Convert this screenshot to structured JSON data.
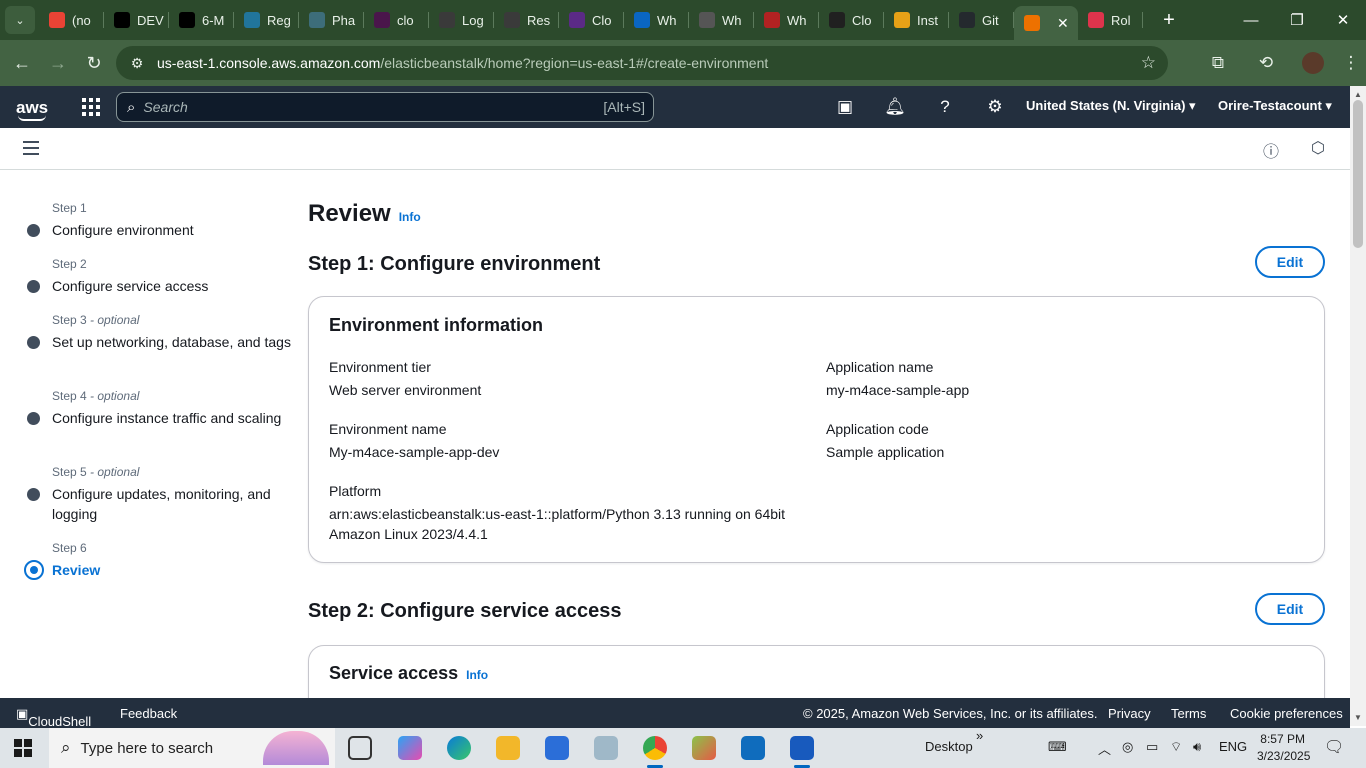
{
  "browser": {
    "tabs": [
      {
        "label": "(no",
        "icon": "gmail-icon",
        "color": "#ea4335"
      },
      {
        "label": "DEV",
        "icon": "dev-icon",
        "color": "#000000"
      },
      {
        "label": "6-M",
        "icon": "circle-icon",
        "color": "#000000"
      },
      {
        "label": "Reg",
        "icon": "wordpress-icon",
        "color": "#21759b"
      },
      {
        "label": "Pha",
        "icon": "globe-icon",
        "color": "#3d6d7a"
      },
      {
        "label": "clo",
        "icon": "slack-icon",
        "color": "#4a154b"
      },
      {
        "label": "Log",
        "icon": "globe-icon",
        "color": "#3a3a3a"
      },
      {
        "label": "Res",
        "icon": "globe-icon",
        "color": "#3a3a3a"
      },
      {
        "label": "Clo",
        "icon": "brand-icon",
        "color": "#5b2a86"
      },
      {
        "label": "Wh",
        "icon": "linkedin-icon",
        "color": "#0a66c2"
      },
      {
        "label": "Wh",
        "icon": "gear-site-icon",
        "color": "#555555"
      },
      {
        "label": "Wh",
        "icon": "spider-icon",
        "color": "#b22222"
      },
      {
        "label": "Clo",
        "icon": "openai-icon",
        "color": "#202020"
      },
      {
        "label": "Inst",
        "icon": "box-icon",
        "color": "#e6a117"
      },
      {
        "label": "Git",
        "icon": "github-icon",
        "color": "#24292e"
      },
      {
        "label": "",
        "icon": "elastic-beanstalk-icon",
        "color": "#ed7100",
        "active": true
      },
      {
        "label": "Rol",
        "icon": "aws-service-icon",
        "color": "#dd344c"
      }
    ],
    "url_host": "us-east-1.console.aws.amazon.com",
    "url_path": "/elasticbeanstalk/home?region=us-east-1#/create-environment"
  },
  "aws": {
    "search_placeholder": "Search",
    "search_shortcut": "[Alt+S]",
    "region": "United States (N. Virginia)",
    "account": "Orire-Testacount"
  },
  "steps": [
    {
      "num": "Step 1",
      "optional": "",
      "title": "Configure environment"
    },
    {
      "num": "Step 2",
      "optional": "",
      "title": "Configure service access"
    },
    {
      "num": "Step 3",
      "optional": " - optional",
      "title": "Set up networking, database, and tags"
    },
    {
      "num": "Step 4",
      "optional": " - optional",
      "title": "Configure instance traffic and scaling"
    },
    {
      "num": "Step 5",
      "optional": " - optional",
      "title": "Configure updates, monitoring, and logging"
    },
    {
      "num": "Step 6",
      "optional": "",
      "title": "Review"
    }
  ],
  "main": {
    "title": "Review",
    "info": "Info",
    "edit": "Edit",
    "step1": {
      "heading": "Step 1: Configure environment",
      "card_title": "Environment information",
      "env_tier_label": "Environment tier",
      "env_tier_value": "Web server environment",
      "app_name_label": "Application name",
      "app_name_value": "my-m4ace-sample-app",
      "env_name_label": "Environment name",
      "env_name_value": "My-m4ace-sample-app-dev",
      "app_code_label": "Application code",
      "app_code_value": "Sample application",
      "platform_label": "Platform",
      "platform_value_1": "arn:aws:elasticbeanstalk:us-east-1::platform/Python 3.13 running on 64bit",
      "platform_value_2": "Amazon Linux 2023/4.4.1"
    },
    "step2": {
      "heading": "Step 2: Configure service access",
      "card_title": "Service access",
      "info": "Info"
    }
  },
  "footer": {
    "cloudshell": "CloudShell",
    "feedback": "Feedback",
    "copyright": "© 2025, Amazon Web Services, Inc. or its affiliates.",
    "privacy": "Privacy",
    "terms": "Terms",
    "cookies": "Cookie preferences"
  },
  "taskbar": {
    "search_placeholder": "Type here to search",
    "desktop": "Desktop",
    "chevron": "»",
    "language": "ENG",
    "time": "8:57 PM",
    "date": "3/23/2025"
  }
}
